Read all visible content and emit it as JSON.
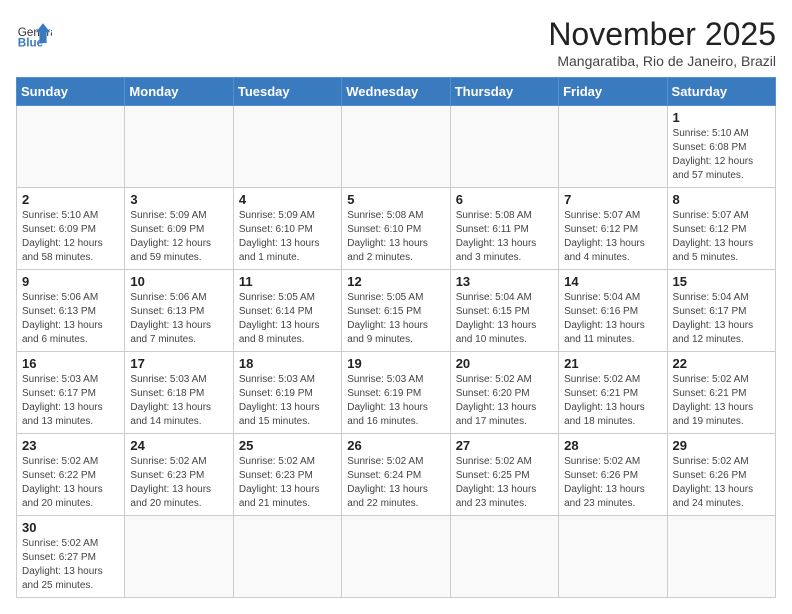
{
  "header": {
    "logo_general": "General",
    "logo_blue": "Blue",
    "month_title": "November 2025",
    "location": "Mangaratiba, Rio de Janeiro, Brazil"
  },
  "days_of_week": [
    "Sunday",
    "Monday",
    "Tuesday",
    "Wednesday",
    "Thursday",
    "Friday",
    "Saturday"
  ],
  "weeks": [
    [
      {
        "day": "",
        "info": ""
      },
      {
        "day": "",
        "info": ""
      },
      {
        "day": "",
        "info": ""
      },
      {
        "day": "",
        "info": ""
      },
      {
        "day": "",
        "info": ""
      },
      {
        "day": "",
        "info": ""
      },
      {
        "day": "1",
        "info": "Sunrise: 5:10 AM\nSunset: 6:08 PM\nDaylight: 12 hours and 57 minutes."
      }
    ],
    [
      {
        "day": "2",
        "info": "Sunrise: 5:10 AM\nSunset: 6:09 PM\nDaylight: 12 hours and 58 minutes."
      },
      {
        "day": "3",
        "info": "Sunrise: 5:09 AM\nSunset: 6:09 PM\nDaylight: 12 hours and 59 minutes."
      },
      {
        "day": "4",
        "info": "Sunrise: 5:09 AM\nSunset: 6:10 PM\nDaylight: 13 hours and 1 minute."
      },
      {
        "day": "5",
        "info": "Sunrise: 5:08 AM\nSunset: 6:10 PM\nDaylight: 13 hours and 2 minutes."
      },
      {
        "day": "6",
        "info": "Sunrise: 5:08 AM\nSunset: 6:11 PM\nDaylight: 13 hours and 3 minutes."
      },
      {
        "day": "7",
        "info": "Sunrise: 5:07 AM\nSunset: 6:12 PM\nDaylight: 13 hours and 4 minutes."
      },
      {
        "day": "8",
        "info": "Sunrise: 5:07 AM\nSunset: 6:12 PM\nDaylight: 13 hours and 5 minutes."
      }
    ],
    [
      {
        "day": "9",
        "info": "Sunrise: 5:06 AM\nSunset: 6:13 PM\nDaylight: 13 hours and 6 minutes."
      },
      {
        "day": "10",
        "info": "Sunrise: 5:06 AM\nSunset: 6:13 PM\nDaylight: 13 hours and 7 minutes."
      },
      {
        "day": "11",
        "info": "Sunrise: 5:05 AM\nSunset: 6:14 PM\nDaylight: 13 hours and 8 minutes."
      },
      {
        "day": "12",
        "info": "Sunrise: 5:05 AM\nSunset: 6:15 PM\nDaylight: 13 hours and 9 minutes."
      },
      {
        "day": "13",
        "info": "Sunrise: 5:04 AM\nSunset: 6:15 PM\nDaylight: 13 hours and 10 minutes."
      },
      {
        "day": "14",
        "info": "Sunrise: 5:04 AM\nSunset: 6:16 PM\nDaylight: 13 hours and 11 minutes."
      },
      {
        "day": "15",
        "info": "Sunrise: 5:04 AM\nSunset: 6:17 PM\nDaylight: 13 hours and 12 minutes."
      }
    ],
    [
      {
        "day": "16",
        "info": "Sunrise: 5:03 AM\nSunset: 6:17 PM\nDaylight: 13 hours and 13 minutes."
      },
      {
        "day": "17",
        "info": "Sunrise: 5:03 AM\nSunset: 6:18 PM\nDaylight: 13 hours and 14 minutes."
      },
      {
        "day": "18",
        "info": "Sunrise: 5:03 AM\nSunset: 6:19 PM\nDaylight: 13 hours and 15 minutes."
      },
      {
        "day": "19",
        "info": "Sunrise: 5:03 AM\nSunset: 6:19 PM\nDaylight: 13 hours and 16 minutes."
      },
      {
        "day": "20",
        "info": "Sunrise: 5:02 AM\nSunset: 6:20 PM\nDaylight: 13 hours and 17 minutes."
      },
      {
        "day": "21",
        "info": "Sunrise: 5:02 AM\nSunset: 6:21 PM\nDaylight: 13 hours and 18 minutes."
      },
      {
        "day": "22",
        "info": "Sunrise: 5:02 AM\nSunset: 6:21 PM\nDaylight: 13 hours and 19 minutes."
      }
    ],
    [
      {
        "day": "23",
        "info": "Sunrise: 5:02 AM\nSunset: 6:22 PM\nDaylight: 13 hours and 20 minutes."
      },
      {
        "day": "24",
        "info": "Sunrise: 5:02 AM\nSunset: 6:23 PM\nDaylight: 13 hours and 20 minutes."
      },
      {
        "day": "25",
        "info": "Sunrise: 5:02 AM\nSunset: 6:23 PM\nDaylight: 13 hours and 21 minutes."
      },
      {
        "day": "26",
        "info": "Sunrise: 5:02 AM\nSunset: 6:24 PM\nDaylight: 13 hours and 22 minutes."
      },
      {
        "day": "27",
        "info": "Sunrise: 5:02 AM\nSunset: 6:25 PM\nDaylight: 13 hours and 23 minutes."
      },
      {
        "day": "28",
        "info": "Sunrise: 5:02 AM\nSunset: 6:26 PM\nDaylight: 13 hours and 23 minutes."
      },
      {
        "day": "29",
        "info": "Sunrise: 5:02 AM\nSunset: 6:26 PM\nDaylight: 13 hours and 24 minutes."
      }
    ],
    [
      {
        "day": "30",
        "info": "Sunrise: 5:02 AM\nSunset: 6:27 PM\nDaylight: 13 hours and 25 minutes."
      },
      {
        "day": "",
        "info": ""
      },
      {
        "day": "",
        "info": ""
      },
      {
        "day": "",
        "info": ""
      },
      {
        "day": "",
        "info": ""
      },
      {
        "day": "",
        "info": ""
      },
      {
        "day": "",
        "info": ""
      }
    ]
  ]
}
